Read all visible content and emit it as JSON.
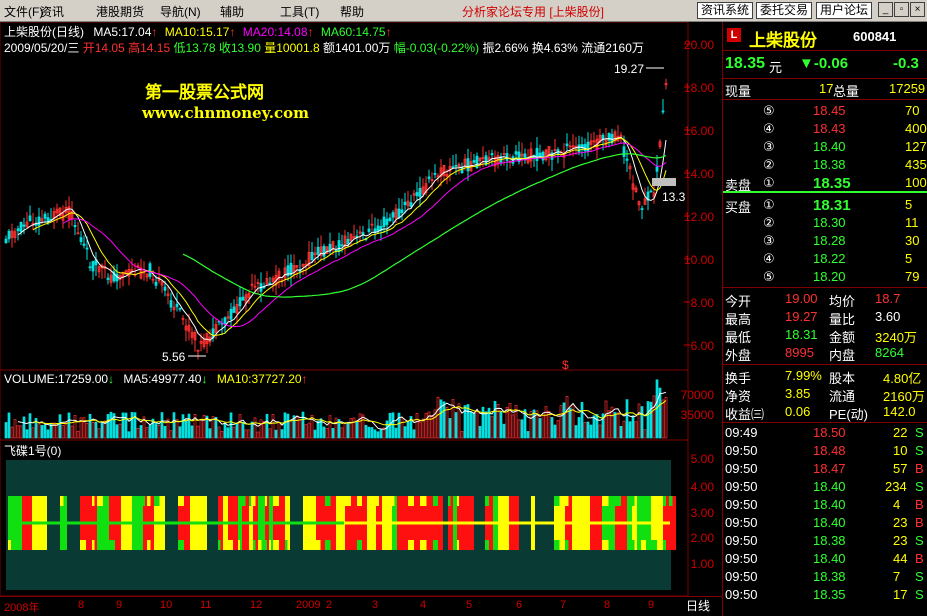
{
  "menu": {
    "items": [
      "文件(F)",
      "资讯",
      "港股期货",
      "导航(N)",
      "辅助",
      "工具(T)",
      "帮助"
    ],
    "title": "分析家论坛专用 [上柴股份]",
    "buttons": [
      "资讯系统",
      "委托交易",
      "用户论坛"
    ]
  },
  "chart_header": {
    "line1_name": "上柴股份(日线)",
    "ma5": "MA5:17.04",
    "ma10": "MA10:15.17",
    "ma20": "MA20:14.08",
    "ma60": "MA60:14.75",
    "line2_date": "2009/05/20/三",
    "open": "开14.05",
    "high": "高14.15",
    "low": "低13.78",
    "close": "收13.90",
    "volume": "量10001.8",
    "amount": "额1401.00万",
    "change": "幅-0.03(-0.22%)",
    "amplitude": "振2.66%",
    "turnover": "换4.63%",
    "float": "流通2160万"
  },
  "watermark": {
    "cn": "第一股票公式网",
    "url": "www.chnmoney.com"
  },
  "annotations": {
    "max_label": "19.27",
    "min_label": "5.56",
    "last_label": "13.3",
    "marker": "$"
  },
  "price_axis": [
    "20.00",
    "18.00",
    "16.00",
    "14.00",
    "12.00",
    "10.00",
    "8.00",
    "6.00"
  ],
  "volume_header": {
    "volume": "VOLUME:17259.00",
    "ma5": "MA5:49977.40",
    "ma10": "MA10:37727.20"
  },
  "volume_axis": [
    "70000",
    "35000"
  ],
  "indicator": {
    "name": "飞碟1号(0)",
    "axis": [
      "5.00",
      "4.00",
      "3.00",
      "2.00",
      "1.00"
    ]
  },
  "date_axis": {
    "ticks": [
      "2008年",
      "8",
      "9",
      "10",
      "11",
      "12",
      "2009",
      "2",
      "3",
      "4",
      "5",
      "6",
      "7",
      "8",
      "9"
    ],
    "period": "日线"
  },
  "quote": {
    "name": "上柴股份",
    "code": "600841",
    "price": "18.35",
    "unit": "元",
    "change": "▼-0.06",
    "change_pct": "-0.3",
    "now_vol_label": "现量",
    "now_vol": "17",
    "total_vol_label": "总量",
    "total_vol": "17259",
    "sell_label": "卖盘",
    "buy_label": "买盘",
    "asks": [
      {
        "lvl": "⑤",
        "price": "18.45",
        "vol": "70"
      },
      {
        "lvl": "④",
        "price": "18.43",
        "vol": "400"
      },
      {
        "lvl": "③",
        "price": "18.40",
        "vol": "127"
      },
      {
        "lvl": "②",
        "price": "18.38",
        "vol": "435"
      },
      {
        "lvl": "①",
        "price": "18.35",
        "vol": "100"
      }
    ],
    "bids": [
      {
        "lvl": "①",
        "price": "18.31",
        "vol": "5"
      },
      {
        "lvl": "②",
        "price": "18.30",
        "vol": "11"
      },
      {
        "lvl": "③",
        "price": "18.28",
        "vol": "30"
      },
      {
        "lvl": "④",
        "price": "18.22",
        "vol": "5"
      },
      {
        "lvl": "⑤",
        "price": "18.20",
        "vol": "79"
      }
    ],
    "stats": [
      {
        "l1": "今开",
        "v1": "19.00",
        "l2": "均价",
        "v2": "18.7"
      },
      {
        "l1": "最高",
        "v1": "19.27",
        "l2": "量比",
        "v2": "3.60"
      },
      {
        "l1": "最低",
        "v1": "18.31",
        "l2": "金额",
        "v2": "3240万"
      },
      {
        "l1": "外盘",
        "v1": "8995",
        "l2": "内盘",
        "v2": "8264"
      }
    ],
    "fundamentals": [
      {
        "l1": "换手",
        "v1": "7.99%",
        "l2": "股本",
        "v2": "4.80亿"
      },
      {
        "l1": "净资",
        "v1": "3.85",
        "l2": "流通",
        "v2": "2160万"
      },
      {
        "l1": "收益㈢",
        "v1": "0.06",
        "l2": "PE(动)",
        "v2": "142.0"
      }
    ],
    "ticks": [
      {
        "t": "09:49",
        "p": "18.50",
        "v": "22",
        "s": "S",
        "c": "red"
      },
      {
        "t": "09:50",
        "p": "18.48",
        "v": "10",
        "s": "S",
        "c": "red"
      },
      {
        "t": "09:50",
        "p": "18.47",
        "v": "57",
        "s": "B",
        "c": "red"
      },
      {
        "t": "09:50",
        "p": "18.40",
        "v": "234",
        "s": "S",
        "c": "green"
      },
      {
        "t": "09:50",
        "p": "18.40",
        "v": "4",
        "s": "B",
        "c": "green"
      },
      {
        "t": "09:50",
        "p": "18.40",
        "v": "23",
        "s": "B",
        "c": "green"
      },
      {
        "t": "09:50",
        "p": "18.38",
        "v": "23",
        "s": "S",
        "c": "green"
      },
      {
        "t": "09:50",
        "p": "18.40",
        "v": "44",
        "s": "B",
        "c": "green"
      },
      {
        "t": "09:50",
        "p": "18.38",
        "v": "7",
        "s": "S",
        "c": "green"
      },
      {
        "t": "09:50",
        "p": "18.35",
        "v": "17",
        "s": "S",
        "c": "green"
      }
    ]
  }
}
